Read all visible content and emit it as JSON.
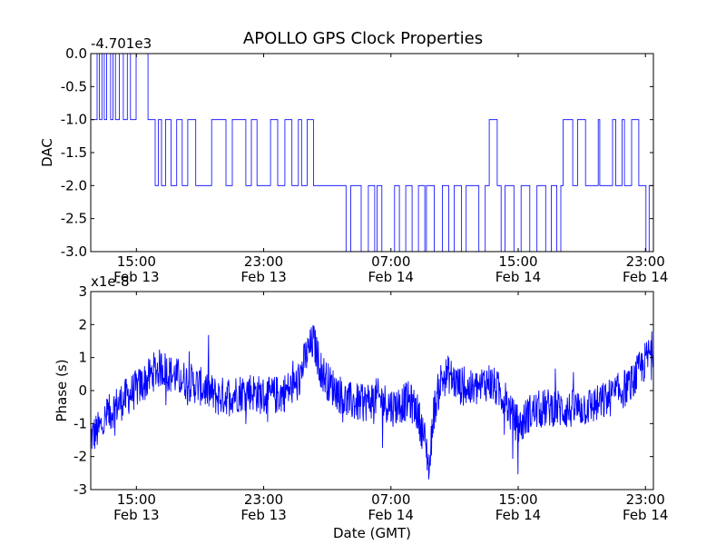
{
  "title": "APOLLO GPS Clock Properties",
  "chart_data": [
    {
      "type": "line",
      "ylabel": "DAC",
      "xlabel": "",
      "offset_text": "-4.701e3",
      "ylim": [
        -3.0,
        0.0
      ],
      "yticks": [
        "0.0",
        "-0.5",
        "-1.0",
        "-1.5",
        "-2.0",
        "-2.5",
        "-3.0"
      ],
      "xticks": [
        {
          "time": "15:00",
          "date": "Feb 13"
        },
        {
          "time": "23:00",
          "date": "Feb 13"
        },
        {
          "time": "07:00",
          "date": "Feb 14"
        },
        {
          "time": "15:00",
          "date": "Feb 14"
        },
        {
          "time": "23:00",
          "date": "Feb 14"
        }
      ],
      "x_range": [
        "Feb 13 12:08",
        "Feb 14 23:30"
      ],
      "series": [
        {
          "color": "#0000ff",
          "x_hours": [
            0,
            0.4,
            0.55,
            0.7,
            0.85,
            1.0,
            1.25,
            1.4,
            1.55,
            1.8,
            2.05,
            2.3,
            2.5,
            2.85,
            3.6,
            4.05,
            4.25,
            4.45,
            4.7,
            5.05,
            5.4,
            5.75,
            6.1,
            6.6,
            7.6,
            8.5,
            8.9,
            9.75,
            10.1,
            10.45,
            11.3,
            11.75,
            12.2,
            12.65,
            13.05,
            13.25,
            13.6,
            14.0,
            16.05,
            16.35,
            17.0,
            17.45,
            17.85,
            18.0,
            18.3,
            19.1,
            19.4,
            19.8,
            20.2,
            20.6,
            21.0,
            21.1,
            21.6,
            22.1,
            22.5,
            22.85,
            23.3,
            23.6,
            24.4,
            24.8,
            25.05,
            25.55,
            25.8,
            26.05,
            26.6,
            27.05,
            27.6,
            28.05,
            28.6,
            28.95,
            29.3,
            29.55,
            29.7,
            30.3,
            30.6,
            31.1,
            31.9,
            32.0,
            32.8,
            33.0,
            33.4,
            33.55,
            34.0,
            34.45,
            34.9,
            35.1,
            35.5,
            35.8
          ],
          "values": [
            -1,
            0,
            -1,
            0,
            -1,
            0,
            -1,
            0,
            -1,
            0,
            -1,
            0,
            -1,
            0,
            -1,
            -2,
            -1,
            -2,
            -1,
            -2,
            -1,
            -2,
            -1,
            -2,
            -1,
            -2,
            -1,
            -2,
            -1,
            -2,
            -1,
            -2,
            -1,
            -2,
            -1,
            -2,
            -1,
            -2,
            -3,
            -2,
            -3,
            -2,
            -3,
            -2,
            -3,
            -2,
            -3,
            -2,
            -3,
            -2,
            -3,
            -2,
            -3,
            -2,
            -3,
            -2,
            -3,
            -2,
            -3,
            -2,
            -1,
            -2,
            -3,
            -2,
            -3,
            -2,
            -3,
            -2,
            -3,
            -2,
            -3,
            -2,
            -1,
            -2,
            -1,
            -2,
            -1,
            -2,
            -1,
            -2,
            -1,
            -2,
            -1,
            -2,
            -3,
            -2,
            -3,
            -2
          ]
        }
      ]
    },
    {
      "type": "line",
      "ylabel": "Phase (s)",
      "xlabel": "Date (GMT)",
      "offset_text": "x1e-8",
      "ylim": [
        -3,
        3
      ],
      "yticks": [
        "3",
        "2",
        "1",
        "0",
        "-1",
        "-2",
        "-3"
      ],
      "xticks": [
        {
          "time": "15:00",
          "date": "Feb 13"
        },
        {
          "time": "23:00",
          "date": "Feb 13"
        },
        {
          "time": "07:00",
          "date": "Feb 14"
        },
        {
          "time": "15:00",
          "date": "Feb 14"
        },
        {
          "time": "23:00",
          "date": "Feb 14"
        }
      ],
      "x_range": [
        "Feb 13 12:08",
        "Feb 14 23:30"
      ],
      "series": [
        {
          "color": "#0000ff",
          "x_hours": [
            0,
            0.5,
            1.0,
            1.5,
            2.0,
            2.5,
            3.0,
            3.5,
            4.0,
            4.5,
            5.0,
            5.5,
            6.0,
            7.0,
            8.0,
            9.0,
            10.0,
            11.0,
            12.0,
            13.0,
            13.5,
            14.0,
            14.5,
            15.0,
            15.5,
            16.0,
            17.0,
            18.0,
            19.0,
            20.0,
            20.5,
            21.0,
            21.3,
            21.5,
            22.0,
            22.5,
            23.0,
            24.0,
            25.0,
            26.0,
            26.5,
            27.0,
            27.5,
            28.0,
            29.0,
            30.0,
            31.0,
            32.0,
            33.0,
            34.0,
            34.5,
            35.0,
            35.5,
            35.8
          ],
          "values": [
            -1.4,
            -1.2,
            -0.8,
            -0.5,
            -0.3,
            -0.1,
            0.1,
            0.3,
            0.6,
            0.7,
            0.5,
            0.4,
            0.3,
            0.1,
            -0.2,
            -0.1,
            0.0,
            -0.2,
            -0.1,
            0.2,
            1.0,
            1.5,
            0.6,
            0.2,
            0.0,
            -0.3,
            -0.4,
            -0.2,
            -0.5,
            -0.3,
            -0.6,
            -1.5,
            -2.4,
            -0.8,
            0.3,
            0.5,
            0.2,
            0.0,
            0.3,
            -0.2,
            -0.8,
            -1.1,
            -0.7,
            -0.6,
            -0.5,
            -0.6,
            -0.5,
            -0.4,
            -0.1,
            0.2,
            0.6,
            1.0,
            1.4,
            1.3
          ]
        }
      ]
    }
  ]
}
